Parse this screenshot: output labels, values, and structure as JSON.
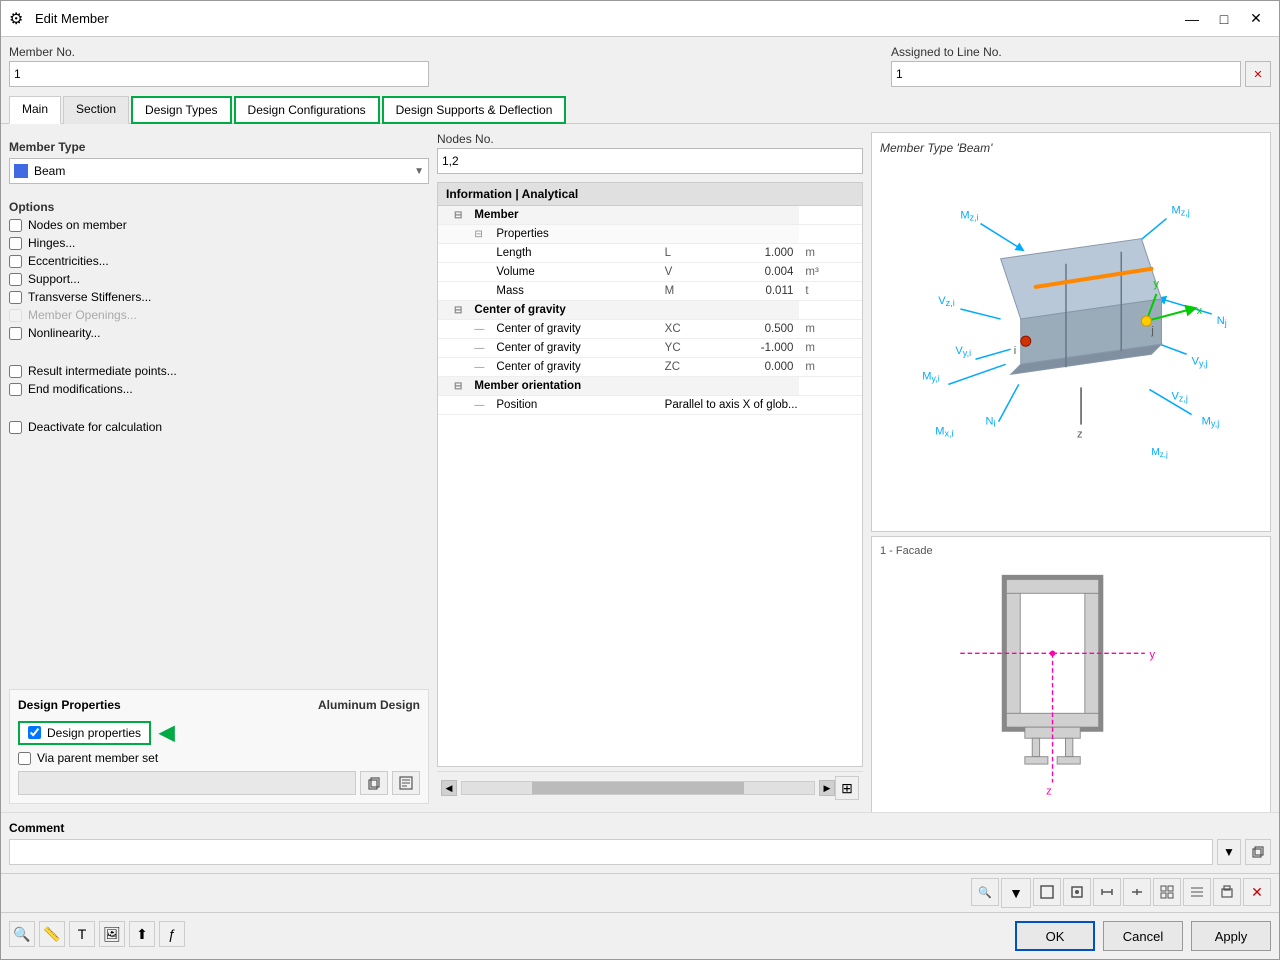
{
  "window": {
    "title": "Edit Member",
    "icon": "⚙"
  },
  "header": {
    "member_no_label": "Member No.",
    "member_no_value": "1",
    "assigned_label": "Assigned to Line No.",
    "assigned_value": "1"
  },
  "tabs": [
    {
      "id": "main",
      "label": "Main",
      "active": true,
      "highlighted": false
    },
    {
      "id": "section",
      "label": "Section",
      "active": false,
      "highlighted": false
    },
    {
      "id": "design_types",
      "label": "Design Types",
      "active": false,
      "highlighted": true
    },
    {
      "id": "design_configurations",
      "label": "Design Configurations",
      "active": false,
      "highlighted": true
    },
    {
      "id": "design_supports",
      "label": "Design Supports & Deflection",
      "active": false,
      "highlighted": true
    }
  ],
  "left": {
    "member_type_label": "Member Type",
    "member_type_value": "Beam",
    "nodes_no_label": "Nodes No.",
    "nodes_no_value": "1,2",
    "options_label": "Options",
    "options": [
      {
        "id": "nodes_on_member",
        "label": "Nodes on member",
        "checked": false,
        "disabled": false
      },
      {
        "id": "hinges",
        "label": "Hinges...",
        "checked": false,
        "disabled": false
      },
      {
        "id": "eccentricities",
        "label": "Eccentricities...",
        "checked": false,
        "disabled": false
      },
      {
        "id": "support",
        "label": "Support...",
        "checked": false,
        "disabled": false
      },
      {
        "id": "transverse_stiffeners",
        "label": "Transverse Stiffeners...",
        "checked": false,
        "disabled": false
      },
      {
        "id": "member_openings",
        "label": "Member Openings...",
        "checked": false,
        "disabled": true
      },
      {
        "id": "nonlinearity",
        "label": "Nonlinearity...",
        "checked": false,
        "disabled": false
      }
    ],
    "options2": [
      {
        "id": "result_intermediate",
        "label": "Result intermediate points...",
        "checked": false,
        "disabled": false
      },
      {
        "id": "end_modifications",
        "label": "End modifications...",
        "checked": false,
        "disabled": false
      },
      {
        "id": "deactivate",
        "label": "Deactivate for calculation",
        "checked": false,
        "disabled": false
      }
    ],
    "design_props_label": "Design Properties",
    "aluminum_design_label": "Aluminum Design",
    "design_properties_checked": true,
    "design_properties_label": "Design properties",
    "via_parent_checked": false,
    "via_parent_label": "Via parent member set"
  },
  "info": {
    "header": "Information | Analytical",
    "sections": [
      {
        "type": "section",
        "label": "Member",
        "expanded": true,
        "children": [
          {
            "type": "subsection",
            "label": "Properties",
            "expanded": true,
            "rows": [
              {
                "label": "Length",
                "sym": "L",
                "value": "1.000",
                "unit": "m"
              },
              {
                "label": "Volume",
                "sym": "V",
                "value": "0.004",
                "unit": "m³"
              },
              {
                "label": "Mass",
                "sym": "M",
                "value": "0.011",
                "unit": "t"
              }
            ]
          }
        ]
      },
      {
        "type": "section",
        "label": "Center of gravity",
        "expanded": true,
        "rows": [
          {
            "label": "Center of gravity",
            "sym": "XC",
            "value": "0.500",
            "unit": "m"
          },
          {
            "label": "Center of gravity",
            "sym": "YC",
            "value": "-1.000",
            "unit": "m"
          },
          {
            "label": "Center of gravity",
            "sym": "ZC",
            "value": "0.000",
            "unit": "m"
          }
        ]
      },
      {
        "type": "section",
        "label": "Member orientation",
        "expanded": true,
        "rows": [
          {
            "label": "Position",
            "sym": "",
            "value": "Parallel to axis X of glob...",
            "unit": ""
          }
        ]
      }
    ]
  },
  "right": {
    "beam_diagram_title": "Member Type 'Beam'",
    "section_label": "1 - Facade"
  },
  "comment": {
    "label": "Comment"
  },
  "buttons": {
    "ok": "OK",
    "cancel": "Cancel",
    "apply": "Apply"
  },
  "icons": {
    "minimize": "—",
    "maximize": "□",
    "close": "✕",
    "expand": "⊟",
    "collapse": "⊞",
    "arrow_left": "◀",
    "arrow_right": "▶",
    "grid": "⊞",
    "search": "🔍",
    "settings": "⚙",
    "copy": "📋"
  }
}
